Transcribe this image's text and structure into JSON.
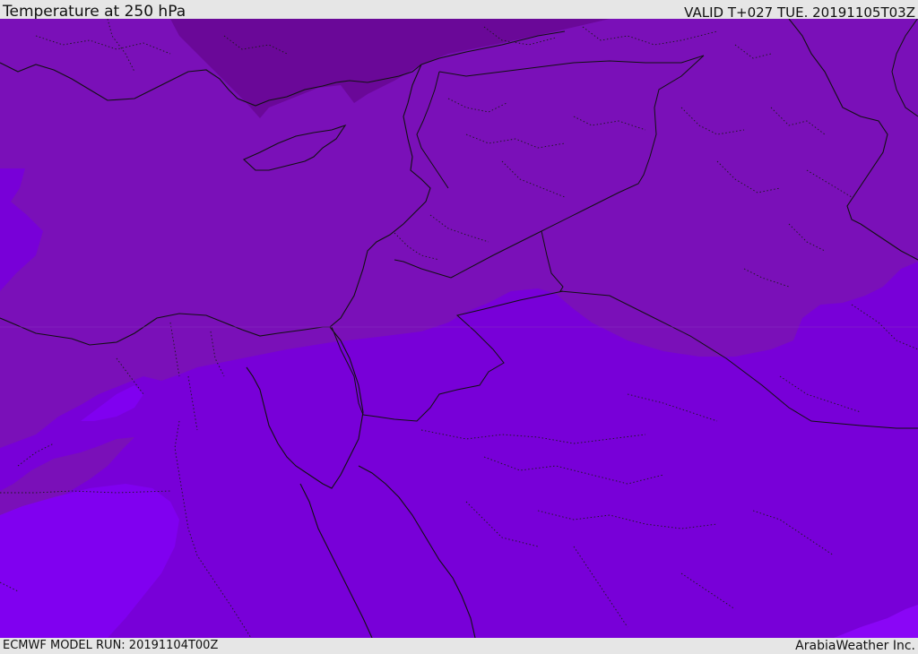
{
  "header": {
    "title": "Temperature at 250 hPa",
    "valid": "VALID T+027 TUE. 20191105T03Z"
  },
  "footer": {
    "model_run": "ECMWF MODEL RUN: 20191104T00Z",
    "credit": "ArabiaWeather Inc."
  },
  "map": {
    "colors": {
      "coldest": "#6a0898",
      "cold": "#7a10b8",
      "mid": "#7800d8",
      "warm": "#8000f0",
      "coastline": "#111111"
    }
  }
}
